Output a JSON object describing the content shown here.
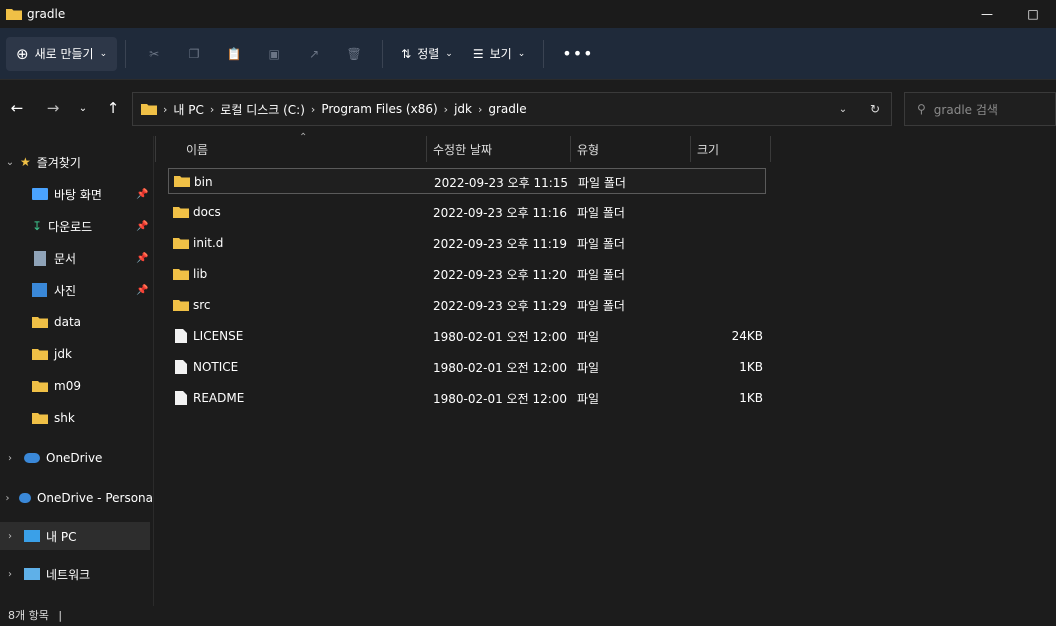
{
  "window": {
    "title": "gradle"
  },
  "toolbar": {
    "new_label": "새로 만들기",
    "sort_label": "정렬",
    "view_label": "보기"
  },
  "address": {
    "segments": [
      "내 PC",
      "로컬 디스크 (C:)",
      "Program Files (x86)",
      "jdk",
      "gradle"
    ]
  },
  "search": {
    "placeholder": "gradle 검색"
  },
  "sidebar": {
    "items": [
      {
        "label": "즐겨찾기"
      },
      {
        "label": "바탕 화면"
      },
      {
        "label": "다운로드"
      },
      {
        "label": "문서"
      },
      {
        "label": "사진"
      },
      {
        "label": "data"
      },
      {
        "label": "jdk"
      },
      {
        "label": "m09"
      },
      {
        "label": "shk"
      },
      {
        "label": "OneDrive"
      },
      {
        "label": "OneDrive - Persona"
      },
      {
        "label": "내 PC"
      },
      {
        "label": "네트워크"
      }
    ]
  },
  "columns": {
    "name": "이름",
    "modified": "수정한 날짜",
    "type": "유형",
    "size": "크기"
  },
  "files": [
    {
      "name": "bin",
      "modified": "2022-09-23 오후 11:15",
      "type": "파일 폴더",
      "size": ""
    },
    {
      "name": "docs",
      "modified": "2022-09-23 오후 11:16",
      "type": "파일 폴더",
      "size": ""
    },
    {
      "name": "init.d",
      "modified": "2022-09-23 오후 11:19",
      "type": "파일 폴더",
      "size": ""
    },
    {
      "name": "lib",
      "modified": "2022-09-23 오후 11:20",
      "type": "파일 폴더",
      "size": ""
    },
    {
      "name": "src",
      "modified": "2022-09-23 오후 11:29",
      "type": "파일 폴더",
      "size": ""
    },
    {
      "name": "LICENSE",
      "modified": "1980-02-01 오전 12:00",
      "type": "파일",
      "size": "24KB"
    },
    {
      "name": "NOTICE",
      "modified": "1980-02-01 오전 12:00",
      "type": "파일",
      "size": "1KB"
    },
    {
      "name": "README",
      "modified": "1980-02-01 오전 12:00",
      "type": "파일",
      "size": "1KB"
    }
  ],
  "status": {
    "count": "8개 항목"
  },
  "colors": {
    "folder": "#f0c046",
    "toolbar_bg": "#1f2a3a",
    "accent": "#4aa3ff"
  }
}
